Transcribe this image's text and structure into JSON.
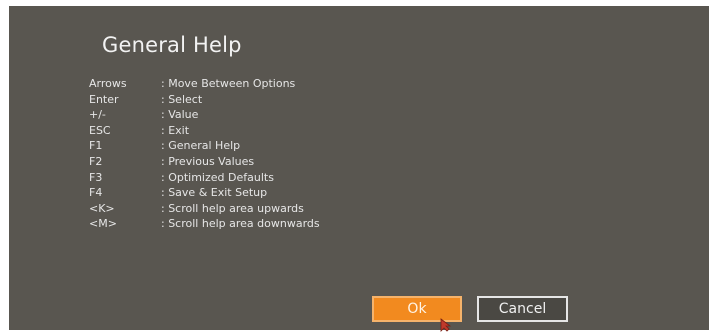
{
  "dialog": {
    "title": "General Help",
    "shortcuts": [
      {
        "key": "Arrows",
        "desc": ": Move Between Options"
      },
      {
        "key": "Enter",
        "desc": ": Select"
      },
      {
        "key": "+/-",
        "desc": ": Value"
      },
      {
        "key": "ESC",
        "desc": ": Exit"
      },
      {
        "key": "F1",
        "desc": ": General Help"
      },
      {
        "key": "F2",
        "desc": ": Previous Values"
      },
      {
        "key": "F3",
        "desc": ": Optimized Defaults"
      },
      {
        "key": "F4",
        "desc": ": Save & Exit Setup"
      },
      {
        "key": "<K>",
        "desc": ": Scroll help area upwards"
      },
      {
        "key": "<M>",
        "desc": ": Scroll help area downwards"
      }
    ],
    "buttons": {
      "ok_label": "Ok",
      "cancel_label": "Cancel"
    }
  },
  "colors": {
    "dialog_background": "#595650",
    "accent": "#f28a1f",
    "text": "#e6e6e6"
  }
}
